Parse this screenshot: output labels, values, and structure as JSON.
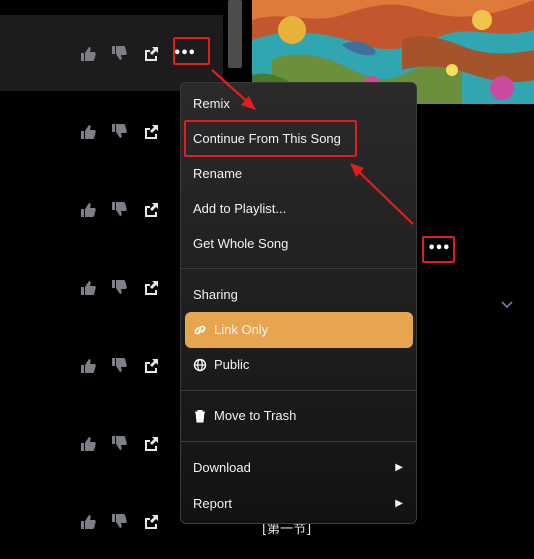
{
  "songs": [
    {
      "more_label": "•••"
    },
    {
      "more_label": ""
    },
    {
      "more_label": ""
    },
    {
      "more_label": ""
    },
    {
      "more_label": ""
    },
    {
      "more_label": ""
    },
    {
      "more_label": ""
    }
  ],
  "menu": {
    "remix": "Remix",
    "continue": "Continue From This Song",
    "rename": "Rename",
    "add_playlist": "Add to Playlist...",
    "get_whole": "Get Whole Song",
    "sharing_header": "Sharing",
    "link_only": "Link Only",
    "public": "Public",
    "trash": "Move to Trash",
    "download": "Download",
    "report": "Report",
    "submenu_arrow": "▶"
  },
  "side_more_label": "•••",
  "bottom_text": "[第一节]",
  "colors": {
    "highlight": "#e8a54f",
    "annotation": "#e11d1d",
    "icon": "#7d7f86"
  }
}
